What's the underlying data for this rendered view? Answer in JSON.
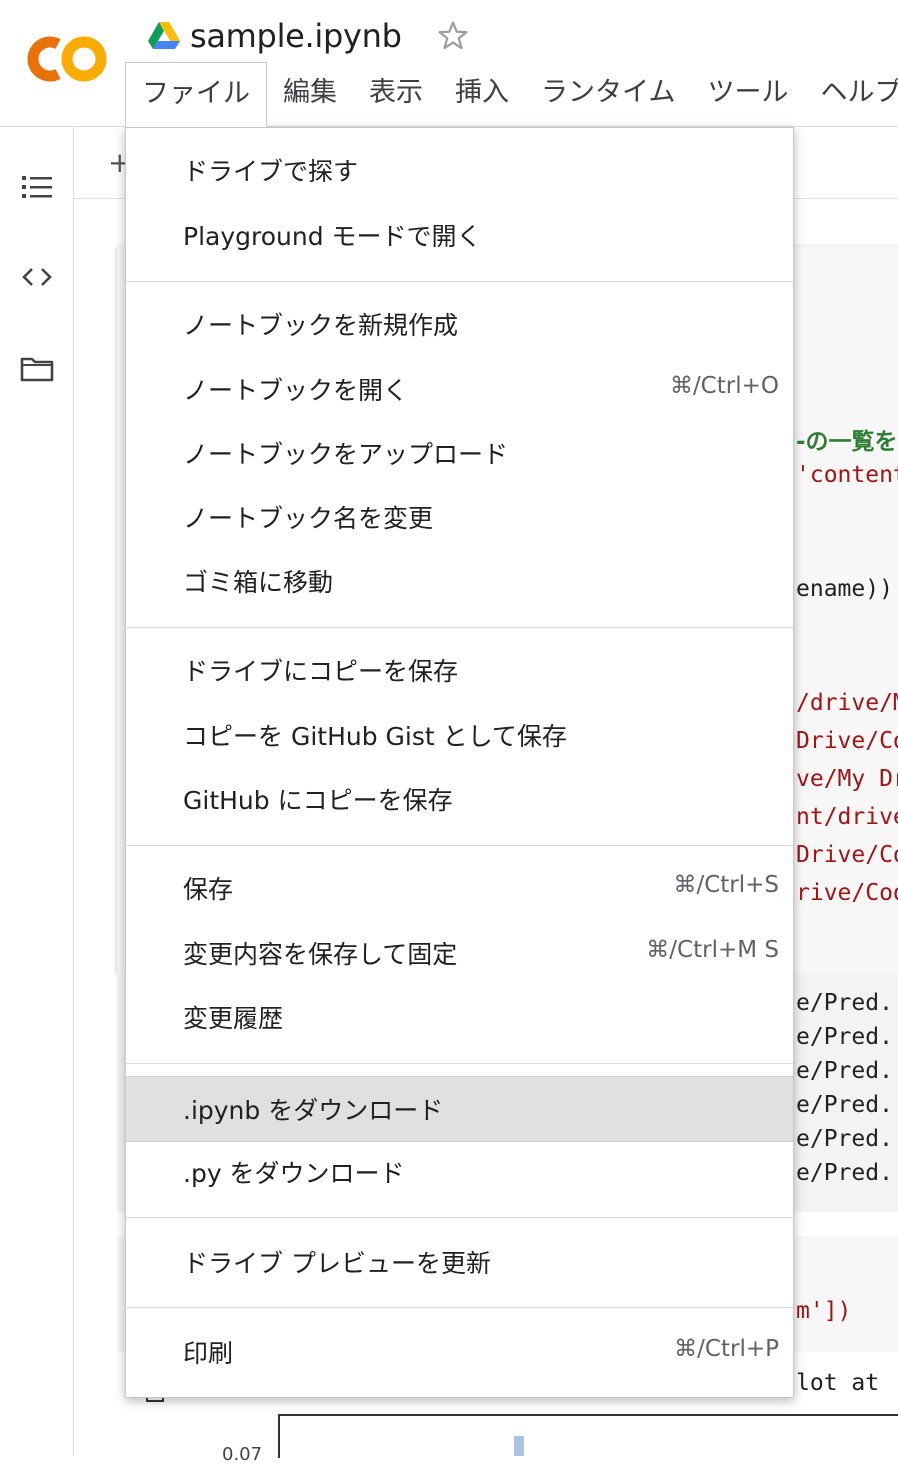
{
  "header": {
    "doc_title": "sample.ipynb",
    "menus": [
      "ファイル",
      "編集",
      "表示",
      "挿入",
      "ランタイム",
      "ツール",
      "ヘルプ"
    ],
    "active_menu_index": 0
  },
  "colors": {
    "logo_orange": "#F9AB00",
    "logo_amber": "#E8710A",
    "menu_highlight": "#e0e0e0",
    "code_string": "#a31515",
    "comment_green": "#2e7d32"
  },
  "icons": {
    "logo": "colab-logo",
    "doc": "google-drive-icon",
    "star": "star-icon",
    "sidebar": [
      "table-of-contents-icon",
      "code-snippets-icon",
      "folder-icon"
    ]
  },
  "toolbar": {
    "plus": "+"
  },
  "background_code": {
    "line1": "-の一覧を",
    "line2": "'content/",
    "line3": "ename))",
    "line4": "/drive/M",
    "line5": "Drive/Co",
    "line6": "ve/My Dr",
    "line7": "nt/drive",
    "line8": "Drive/Co",
    "line9": "rive/Coo",
    "out1": "e/Pred.",
    "out2": "e/Pred.",
    "out3": "e/Pred.",
    "out4": "e/Pred.",
    "out5": "e/Pred.",
    "out6": "e/Pred.",
    "line10": "m'])",
    "line11": "lot at",
    "tick": "0.07"
  },
  "file_menu": {
    "items": [
      {
        "label": "ドライブで探す",
        "shortcut": ""
      },
      {
        "label": "Playground モードで開く",
        "shortcut": ""
      },
      {
        "label": "ノートブックを新規作成",
        "shortcut": ""
      },
      {
        "label": "ノートブックを開く",
        "shortcut": "⌘/Ctrl+O"
      },
      {
        "label": "ノートブックをアップロード",
        "shortcut": ""
      },
      {
        "label": "ノートブック名を変更",
        "shortcut": ""
      },
      {
        "label": "ゴミ箱に移動",
        "shortcut": ""
      },
      {
        "label": "ドライブにコピーを保存",
        "shortcut": ""
      },
      {
        "label": "コピーを GitHub Gist として保存",
        "shortcut": ""
      },
      {
        "label": "GitHub にコピーを保存",
        "shortcut": ""
      },
      {
        "label": "保存",
        "shortcut": "⌘/Ctrl+S"
      },
      {
        "label": "変更内容を保存して固定",
        "shortcut": "⌘/Ctrl+M S"
      },
      {
        "label": "変更履歴",
        "shortcut": ""
      },
      {
        "label": ".ipynb をダウンロード",
        "shortcut": ""
      },
      {
        "label": ".py をダウンロード",
        "shortcut": ""
      },
      {
        "label": "ドライブ プレビューを更新",
        "shortcut": ""
      },
      {
        "label": "印刷",
        "shortcut": "⌘/Ctrl+P"
      }
    ],
    "highlighted_index": 13
  }
}
